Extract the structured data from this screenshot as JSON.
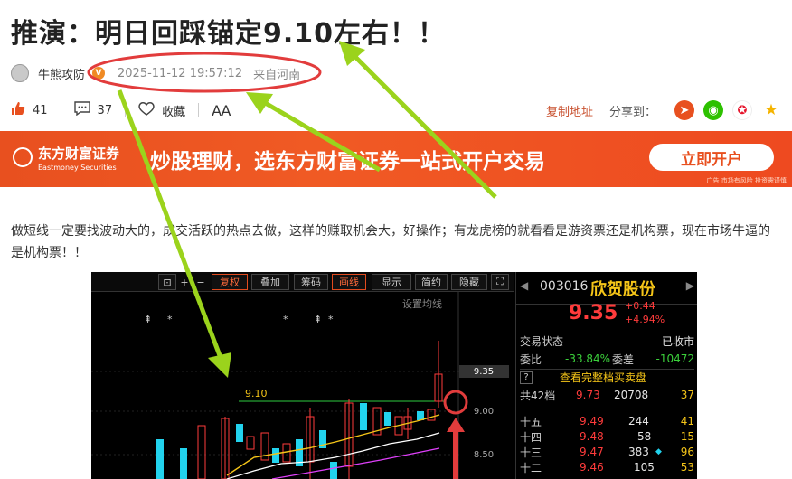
{
  "article": {
    "title": "推演：明日回踩锚定9.10左右！！",
    "author": "牛熊攻防",
    "time": "2025-11-12 19:57:12",
    "location": "来自河南",
    "likes": "41",
    "comments": "37",
    "favorite_label": "收藏",
    "font_label": "AA",
    "copy_label": "复制地址",
    "share_label": "分享到：",
    "paragraph": "做短线一定要找波动大的，成交活跃的热点去做，这样的赚取机会大，好操作；有龙虎榜的就看看是游资票还是机构票，现在市场牛逼的是机构票！！"
  },
  "banner": {
    "brand_cn": "东方财富证券",
    "brand_en": "Eastmoney Securities",
    "slogan": "炒股理财，选东方财富证券一站式开户交易",
    "button": "立即开户",
    "ad_note": "广告 市场有风险 投资需谨慎"
  },
  "chart_toolbar": {
    "buttons": [
      "复权",
      "叠加",
      "筹码",
      "画线",
      "显示",
      "简约",
      "隐藏"
    ],
    "set_ma": "设置均线"
  },
  "kline": {
    "line_label": "9.10",
    "price_labels": [
      "9.35",
      "9.00",
      "8.50"
    ]
  },
  "quote": {
    "code": "003016",
    "name": "欣贺股份",
    "price": "9.35",
    "change": "+0.44",
    "change_pct": "+4.94%",
    "status_label": "交易状态",
    "status_value": "已收市",
    "weibi_label": "委比",
    "weibi_value": "-33.84%",
    "weicha_label": "委差",
    "weicha_value": "-10472",
    "full_book": "查看完整档买卖盘",
    "total_label": "共42档",
    "total_price": "9.73",
    "total_vol": "20708",
    "total_count": "37",
    "levels": [
      {
        "label": "十五",
        "price": "9.49",
        "vol": "244",
        "count": "41"
      },
      {
        "label": "十四",
        "price": "9.48",
        "vol": "58",
        "count": "15"
      },
      {
        "label": "十三",
        "price": "9.47",
        "vol": "383",
        "count": "96"
      },
      {
        "label": "十二",
        "price": "9.46",
        "vol": "105",
        "count": "53"
      }
    ]
  },
  "colors": {
    "accent": "#e8501f",
    "annotation_red": "#e23c3c",
    "arrow_green": "#9bd31c"
  }
}
